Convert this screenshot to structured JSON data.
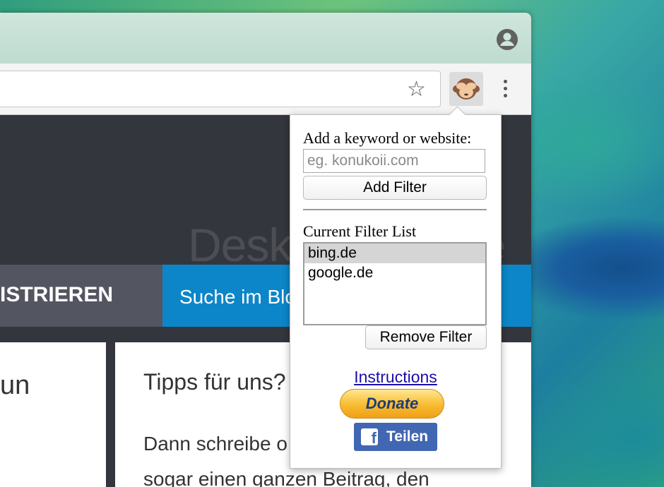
{
  "page": {
    "watermark": "Deskmodder.de",
    "nav_register": "ISTRIEREN",
    "nav_search": "Suche im Blo",
    "card1_text": "un",
    "card2_heading": "Tipps für uns?",
    "card2_line1": "Dann schreibe o",
    "card2_line2": "sogar einen ganzen Beitrag, den"
  },
  "popup": {
    "add_label": "Add a keyword or website:",
    "input_placeholder": "eg. konukoii.com",
    "input_value": "",
    "add_button": "Add Filter",
    "list_label": "Current Filter List",
    "filters": [
      "bing.de",
      "google.de"
    ],
    "selected_index": 0,
    "remove_button": "Remove Filter",
    "instructions_link": "Instructions",
    "donate_button": "Donate",
    "share_button": "Teilen"
  },
  "icons": {
    "profile": "profile-icon",
    "bookmark": "star-icon",
    "extension": "see-no-evil-monkey-icon",
    "menu": "more-vertical-icon",
    "facebook": "facebook-icon"
  },
  "colors": {
    "nav_blue": "#0c86c8",
    "nav_dark": "#535561",
    "link": "#1a0dab",
    "facebook": "#4267b2"
  }
}
